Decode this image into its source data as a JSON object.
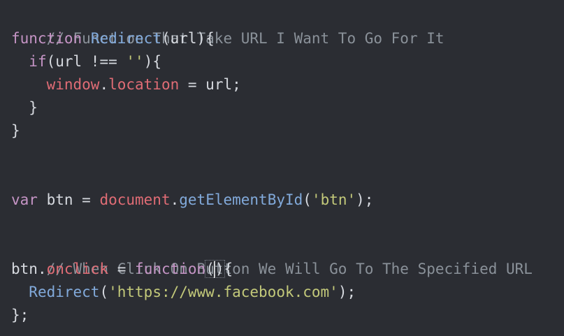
{
  "editor": {
    "line1": {
      "comment": "// Function That Take URL I Want To Go For It"
    },
    "line2": {
      "kw": "function",
      "name": "Redirect",
      "open": "(url){"
    },
    "line3": {
      "indent": "  ",
      "kw": "if",
      "rest": "(url !== ",
      "str": "''",
      "close": "){"
    },
    "line4": {
      "indent": "    ",
      "obj": "window",
      "dot": ".",
      "prop": "location",
      "rest": " = url;"
    },
    "line5": {
      "text": "  }"
    },
    "line6": {
      "text": "}"
    },
    "line7": {
      "kw": "var",
      "ident": " btn = ",
      "obj": "document",
      "dot": ".",
      "method": "getElementById",
      "open": "(",
      "str": "'btn'",
      "close": ");"
    },
    "line8": {
      "comment": "// When Click On Button We Will Go To The Specified URL"
    },
    "line9": {
      "ident": "btn",
      "dot": ".",
      "prop": "onclick",
      "eq": " = ",
      "kw": "function",
      "paren_open": "(",
      "paren_close": ")",
      "brace": "{"
    },
    "line10": {
      "indent": "  ",
      "name": "Redirect",
      "open": "(",
      "str": "'https://www.facebook.com'",
      "close": ");"
    },
    "line11": {
      "text": "};"
    }
  }
}
